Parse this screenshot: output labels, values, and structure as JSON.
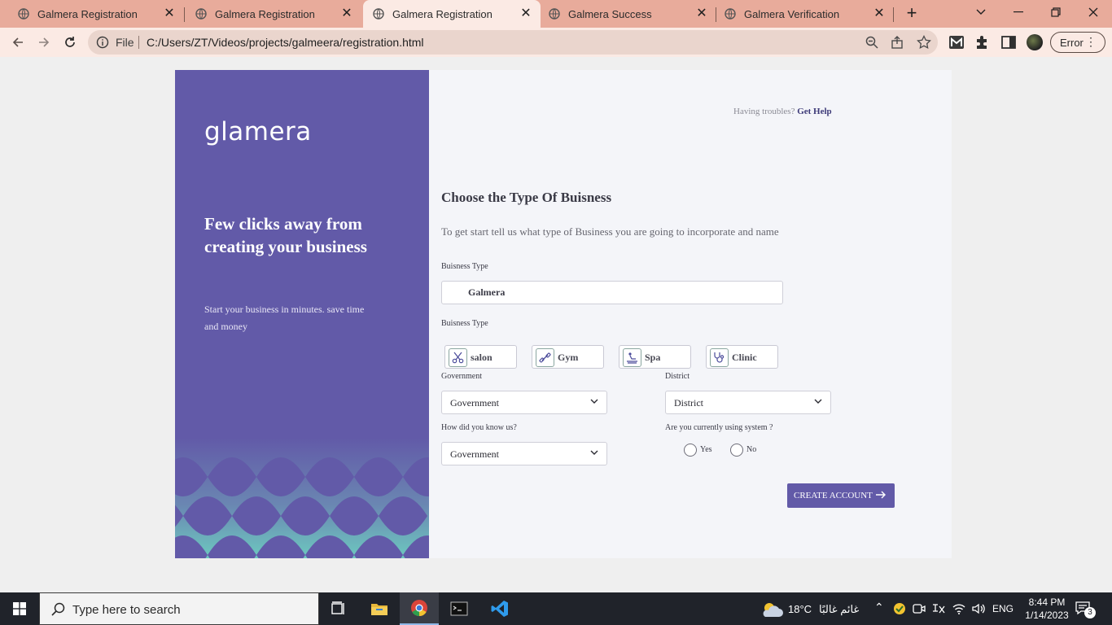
{
  "browser": {
    "tabs": [
      {
        "title": "Galmera Registration",
        "active": false
      },
      {
        "title": "Galmera Registration",
        "active": false
      },
      {
        "title": "Galmera Registration",
        "active": true
      },
      {
        "title": "Galmera Success",
        "active": false
      },
      {
        "title": "Galmera Verification",
        "active": false
      }
    ],
    "address": {
      "scheme_label": "File",
      "url": "C:/Users/ZT/Videos/projects/galmeera/registration.html"
    },
    "profile_error_label": "Error",
    "colors": {
      "tabbar": "#e8ab9b",
      "toolbar": "#fbeae4"
    }
  },
  "left_panel": {
    "logo_text": "glamera",
    "headline": "Few clicks away from creating your business",
    "subtext": "Start your business in minutes. save time and money",
    "colors": {
      "background": "#625aa8",
      "pattern_light": "#6dc8bf"
    }
  },
  "form": {
    "help_prefix": "Having troubles?",
    "help_link": "Get Help",
    "title": "Choose the Type Of Buisness",
    "subtitle": "To get start tell us what type of Business you are going to incorporate and name",
    "business_name_label": "Buisness Type",
    "business_name_value": "Galmera",
    "business_type_label": "Buisness Type",
    "business_types": [
      {
        "label": "salon",
        "icon": "scissors-icon"
      },
      {
        "label": "Gym",
        "icon": "dumbbell-icon"
      },
      {
        "label": "Spa",
        "icon": "massage-icon"
      },
      {
        "label": "Clinic",
        "icon": "stethoscope-icon"
      }
    ],
    "government_label": "Government",
    "government_value": "Government",
    "district_label": "District",
    "district_value": "District",
    "know_us_label": "How did you know us?",
    "know_us_value": "Government",
    "using_system_label": "Are you currently using system ?",
    "yes_label": "Yes",
    "no_label": "No",
    "submit_label": "CREATE ACCOUNT",
    "accent_color": "#625aa8"
  },
  "taskbar": {
    "search_placeholder": "Type here to search",
    "weather_temp": "18°C",
    "weather_desc": "غائم غالبًا",
    "language": "ENG",
    "time": "8:44 PM",
    "date": "1/14/2023",
    "notification_count": "3"
  }
}
